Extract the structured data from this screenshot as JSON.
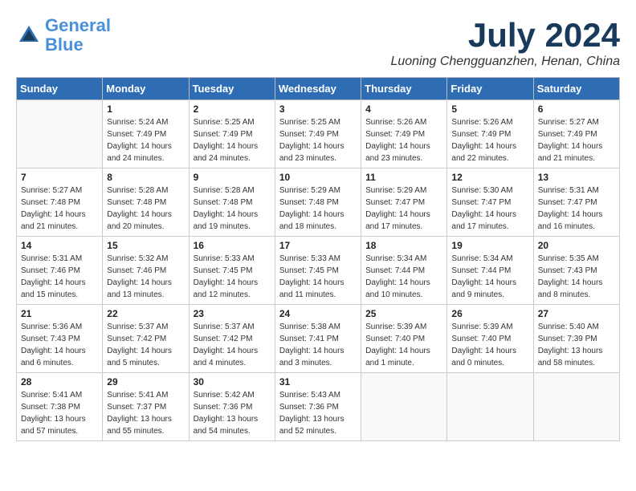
{
  "header": {
    "logo_line1": "General",
    "logo_line2": "Blue",
    "month_year": "July 2024",
    "location": "Luoning Chengguanzhen, Henan, China"
  },
  "weekdays": [
    "Sunday",
    "Monday",
    "Tuesday",
    "Wednesday",
    "Thursday",
    "Friday",
    "Saturday"
  ],
  "weeks": [
    [
      {
        "day": "",
        "info": ""
      },
      {
        "day": "1",
        "info": "Sunrise: 5:24 AM\nSunset: 7:49 PM\nDaylight: 14 hours\nand 24 minutes."
      },
      {
        "day": "2",
        "info": "Sunrise: 5:25 AM\nSunset: 7:49 PM\nDaylight: 14 hours\nand 24 minutes."
      },
      {
        "day": "3",
        "info": "Sunrise: 5:25 AM\nSunset: 7:49 PM\nDaylight: 14 hours\nand 23 minutes."
      },
      {
        "day": "4",
        "info": "Sunrise: 5:26 AM\nSunset: 7:49 PM\nDaylight: 14 hours\nand 23 minutes."
      },
      {
        "day": "5",
        "info": "Sunrise: 5:26 AM\nSunset: 7:49 PM\nDaylight: 14 hours\nand 22 minutes."
      },
      {
        "day": "6",
        "info": "Sunrise: 5:27 AM\nSunset: 7:49 PM\nDaylight: 14 hours\nand 21 minutes."
      }
    ],
    [
      {
        "day": "7",
        "info": "Sunrise: 5:27 AM\nSunset: 7:48 PM\nDaylight: 14 hours\nand 21 minutes."
      },
      {
        "day": "8",
        "info": "Sunrise: 5:28 AM\nSunset: 7:48 PM\nDaylight: 14 hours\nand 20 minutes."
      },
      {
        "day": "9",
        "info": "Sunrise: 5:28 AM\nSunset: 7:48 PM\nDaylight: 14 hours\nand 19 minutes."
      },
      {
        "day": "10",
        "info": "Sunrise: 5:29 AM\nSunset: 7:48 PM\nDaylight: 14 hours\nand 18 minutes."
      },
      {
        "day": "11",
        "info": "Sunrise: 5:29 AM\nSunset: 7:47 PM\nDaylight: 14 hours\nand 17 minutes."
      },
      {
        "day": "12",
        "info": "Sunrise: 5:30 AM\nSunset: 7:47 PM\nDaylight: 14 hours\nand 17 minutes."
      },
      {
        "day": "13",
        "info": "Sunrise: 5:31 AM\nSunset: 7:47 PM\nDaylight: 14 hours\nand 16 minutes."
      }
    ],
    [
      {
        "day": "14",
        "info": "Sunrise: 5:31 AM\nSunset: 7:46 PM\nDaylight: 14 hours\nand 15 minutes."
      },
      {
        "day": "15",
        "info": "Sunrise: 5:32 AM\nSunset: 7:46 PM\nDaylight: 14 hours\nand 13 minutes."
      },
      {
        "day": "16",
        "info": "Sunrise: 5:33 AM\nSunset: 7:45 PM\nDaylight: 14 hours\nand 12 minutes."
      },
      {
        "day": "17",
        "info": "Sunrise: 5:33 AM\nSunset: 7:45 PM\nDaylight: 14 hours\nand 11 minutes."
      },
      {
        "day": "18",
        "info": "Sunrise: 5:34 AM\nSunset: 7:44 PM\nDaylight: 14 hours\nand 10 minutes."
      },
      {
        "day": "19",
        "info": "Sunrise: 5:34 AM\nSunset: 7:44 PM\nDaylight: 14 hours\nand 9 minutes."
      },
      {
        "day": "20",
        "info": "Sunrise: 5:35 AM\nSunset: 7:43 PM\nDaylight: 14 hours\nand 8 minutes."
      }
    ],
    [
      {
        "day": "21",
        "info": "Sunrise: 5:36 AM\nSunset: 7:43 PM\nDaylight: 14 hours\nand 6 minutes."
      },
      {
        "day": "22",
        "info": "Sunrise: 5:37 AM\nSunset: 7:42 PM\nDaylight: 14 hours\nand 5 minutes."
      },
      {
        "day": "23",
        "info": "Sunrise: 5:37 AM\nSunset: 7:42 PM\nDaylight: 14 hours\nand 4 minutes."
      },
      {
        "day": "24",
        "info": "Sunrise: 5:38 AM\nSunset: 7:41 PM\nDaylight: 14 hours\nand 3 minutes."
      },
      {
        "day": "25",
        "info": "Sunrise: 5:39 AM\nSunset: 7:40 PM\nDaylight: 14 hours\nand 1 minute."
      },
      {
        "day": "26",
        "info": "Sunrise: 5:39 AM\nSunset: 7:40 PM\nDaylight: 14 hours\nand 0 minutes."
      },
      {
        "day": "27",
        "info": "Sunrise: 5:40 AM\nSunset: 7:39 PM\nDaylight: 13 hours\nand 58 minutes."
      }
    ],
    [
      {
        "day": "28",
        "info": "Sunrise: 5:41 AM\nSunset: 7:38 PM\nDaylight: 13 hours\nand 57 minutes."
      },
      {
        "day": "29",
        "info": "Sunrise: 5:41 AM\nSunset: 7:37 PM\nDaylight: 13 hours\nand 55 minutes."
      },
      {
        "day": "30",
        "info": "Sunrise: 5:42 AM\nSunset: 7:36 PM\nDaylight: 13 hours\nand 54 minutes."
      },
      {
        "day": "31",
        "info": "Sunrise: 5:43 AM\nSunset: 7:36 PM\nDaylight: 13 hours\nand 52 minutes."
      },
      {
        "day": "",
        "info": ""
      },
      {
        "day": "",
        "info": ""
      },
      {
        "day": "",
        "info": ""
      }
    ]
  ]
}
